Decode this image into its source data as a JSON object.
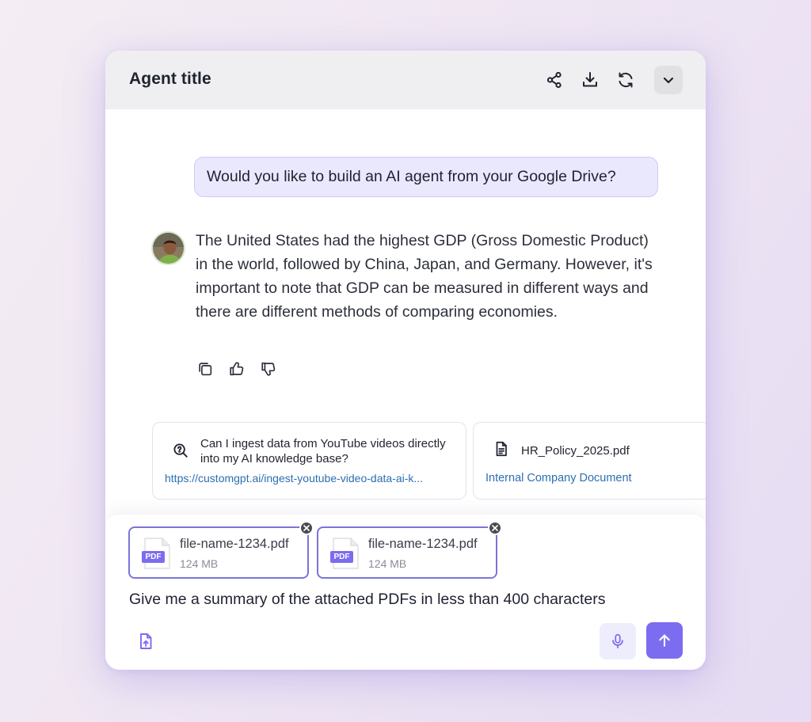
{
  "header": {
    "title": "Agent title",
    "actions": [
      "share-icon",
      "download-icon",
      "refresh-icon",
      "chevron-down-icon"
    ]
  },
  "conversation": {
    "user_message": "Would you like to build an AI agent from your Google Drive?",
    "assistant_message": "The United States had the highest GDP (Gross Domestic Product) in the world, followed by China, Japan, and Germany. However, it's important to note that GDP can be measured in different ways and there are different methods of comparing economies.",
    "message_actions": [
      "copy-icon",
      "thumbs-up-icon",
      "thumbs-down-icon"
    ]
  },
  "sources": [
    {
      "title": "Can I ingest data from YouTube videos directly into my AI knowledge base?",
      "link": "https://customgpt.ai/ingest-youtube-video-data-ai-k...",
      "icon": "search-doc-icon"
    },
    {
      "title": "HR_Policy_2025.pdf",
      "link": "Internal Company Document",
      "icon": "file-icon"
    }
  ],
  "composer": {
    "attachments": [
      {
        "name": "file-name-1234.pdf",
        "size": "124 MB",
        "badge": "PDF"
      },
      {
        "name": "file-name-1234.pdf",
        "size": "124 MB",
        "badge": "PDF"
      }
    ],
    "prompt": "Give me a summary of the attached PDFs in less than 400 characters"
  },
  "colors": {
    "accent": "#7c6cf0",
    "user_bubble": "#eae8fd",
    "link": "#2d6fb0",
    "attachment_border": "#7b74d9"
  }
}
